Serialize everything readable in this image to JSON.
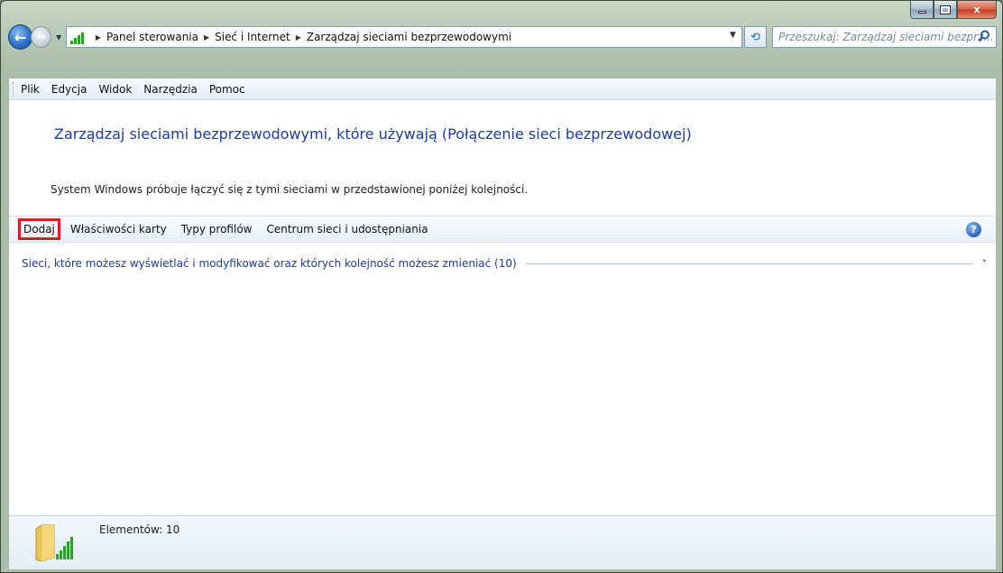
{
  "window": {
    "controls": {
      "close_glyph": "x"
    }
  },
  "nav": {
    "back_glyph": "←",
    "forward_glyph": "→",
    "breadcrumbs": [
      "Panel sterowania",
      "Sieć i Internet",
      "Zarządzaj sieciami bezprzewodowymi"
    ],
    "refresh_glyph": "⟲",
    "search_placeholder": "Przeszukaj: Zarządzaj sieciami bezprz..."
  },
  "menu": {
    "items": [
      "Plik",
      "Edycja",
      "Widok",
      "Narzędzia",
      "Pomoc"
    ]
  },
  "content": {
    "title": "Zarządzaj sieciami bezprzewodowymi, które używają (Połączenie sieci bezprzewodowej)",
    "description": "System Windows próbuje łączyć się z tymi sieciami w przedstawionej poniżej kolejności.",
    "toolbar": {
      "buttons": [
        "Dodaj",
        "Właściwości karty",
        "Typy profilów",
        "Centrum sieci i udostępniania"
      ],
      "highlight_color": "#e01b24",
      "help_glyph": "?"
    },
    "group": {
      "label": "Sieci, które możesz wyświetlać i modyfikować oraz których kolejność możesz zmieniać (10)",
      "chevron_glyph": "˅"
    }
  },
  "status": {
    "text": "Elementów: 10"
  },
  "colors": {
    "link_blue": "#1e3da3",
    "signal_green": "#2ea02e"
  },
  "icons": [
    "back-arrow-icon",
    "forward-arrow-icon",
    "wireless-signal-icon",
    "refresh-icon",
    "search-icon",
    "help-icon",
    "chevron-down-icon",
    "network-folder-icon"
  ]
}
